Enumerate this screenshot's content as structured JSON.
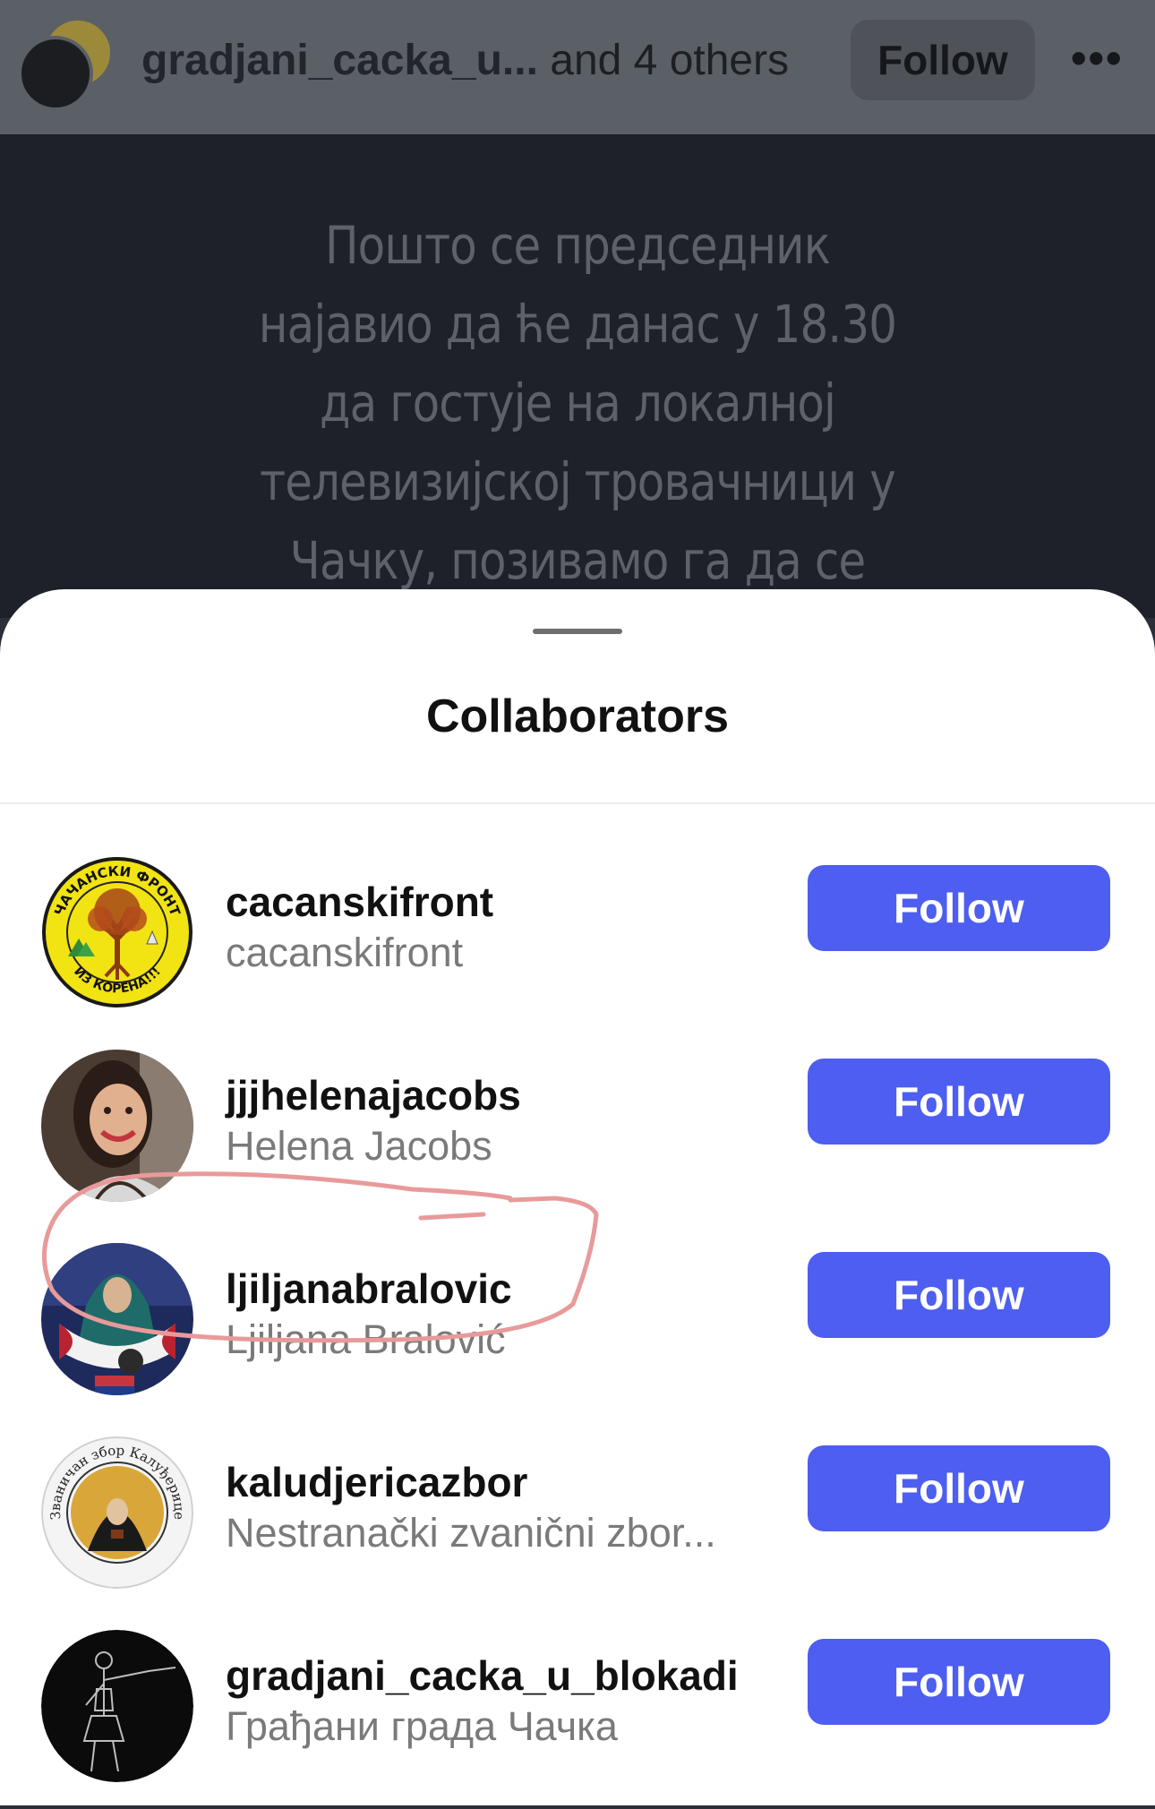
{
  "header": {
    "title_user": "gradjani_cacka_u...",
    "title_rest": " and 4 others",
    "follow_label": "Follow",
    "more_label": "•••"
  },
  "post": {
    "lines": [
      "Пошто се председник",
      "најавио да ће данас у 18.30",
      "да гостује на локалној",
      "телевизијској тровачници у",
      "Чачку, позивамо га да се"
    ]
  },
  "sheet": {
    "title": "Collaborators",
    "items": [
      {
        "username": "cacanskifront",
        "full_name": "cacanskifront",
        "follow_label": "Follow",
        "avatar_text_top": "ЧАЧАНСКИ ФРОНТ",
        "avatar_text_bottom": "ИЗ КОРЕНА!!!"
      },
      {
        "username": "jjjhelenajacobs",
        "full_name": "Helena Jacobs",
        "follow_label": "Follow"
      },
      {
        "username": "ljiljanabralovic",
        "full_name": "Ljiljana Bralović",
        "follow_label": "Follow"
      },
      {
        "username": "kaludjericazbor",
        "full_name": "Nestranački zvanični zbor...",
        "follow_label": "Follow",
        "avatar_text": "Званичан збор Калуђерице"
      },
      {
        "username": "gradjani_cacka_u_blokadi",
        "full_name": "Грађани града Чачка",
        "follow_label": "Follow"
      }
    ]
  },
  "colors": {
    "follow_button": "#4d5ef0",
    "annotation": "#e89a9a"
  }
}
